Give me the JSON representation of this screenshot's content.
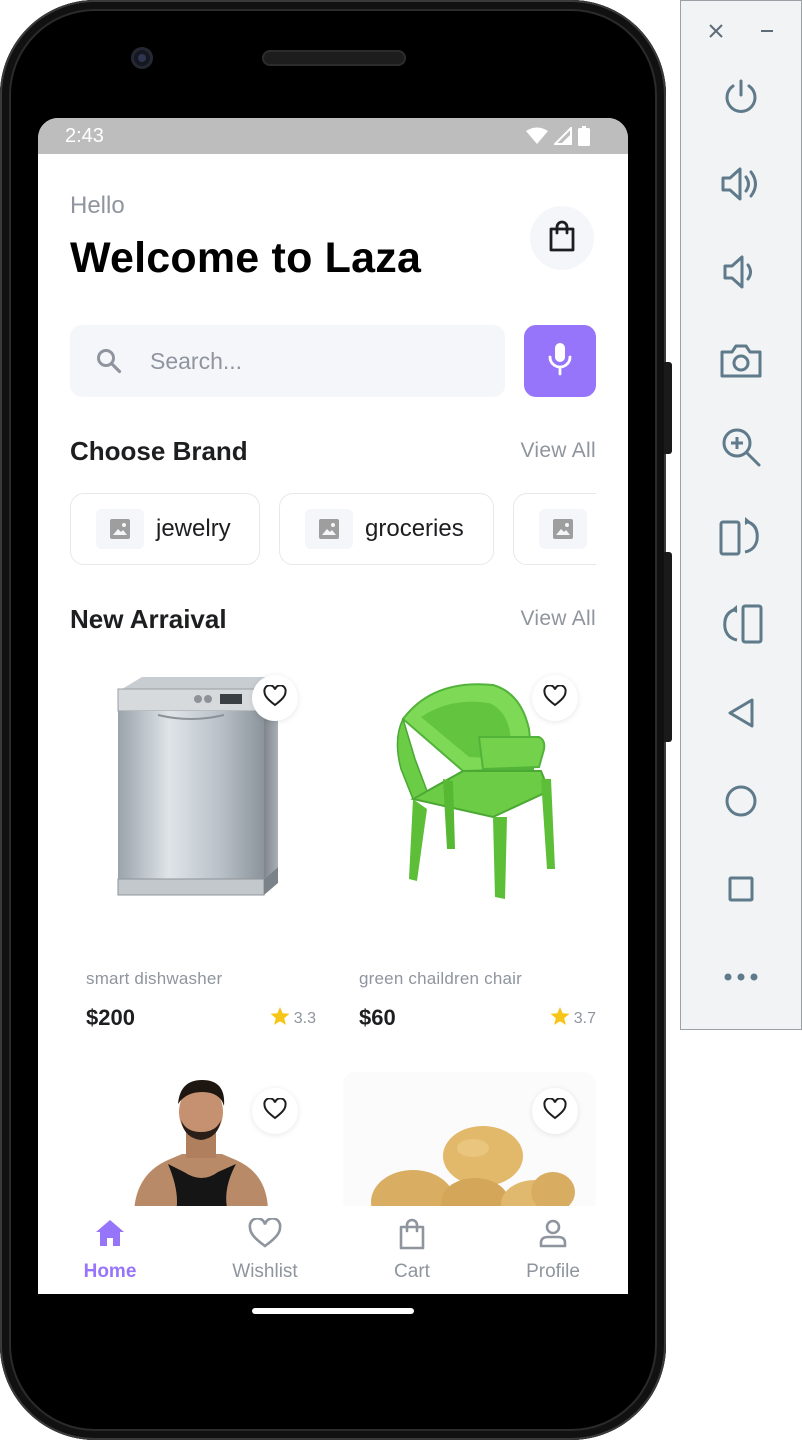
{
  "status_bar": {
    "time": "2:43"
  },
  "header": {
    "greeting": "Hello",
    "title": "Welcome to Laza"
  },
  "search": {
    "placeholder": "Search..."
  },
  "brands_section": {
    "title": "Choose Brand",
    "view_all": "View All",
    "items": [
      {
        "label": "jewelry"
      },
      {
        "label": "groceries"
      },
      {
        "label": ""
      }
    ]
  },
  "arrivals_section": {
    "title": "New Arraival",
    "view_all": "View All",
    "products": [
      {
        "name": "smart dishwasher",
        "price": "$200",
        "rating": "3.3",
        "image": "dishwasher"
      },
      {
        "name": "green chaildren chair",
        "price": "$60",
        "rating": "3.7",
        "image": "green-chair"
      },
      {
        "name": "",
        "price": "",
        "rating": "",
        "image": "man-tank-top"
      },
      {
        "name": "",
        "price": "",
        "rating": "",
        "image": "potatoes"
      }
    ]
  },
  "bottom_nav": {
    "items": [
      {
        "label": "Home",
        "icon": "home-icon",
        "active": true
      },
      {
        "label": "Wishlist",
        "icon": "heart-icon",
        "active": false
      },
      {
        "label": "Cart",
        "icon": "bag-icon",
        "active": false
      },
      {
        "label": "Profile",
        "icon": "person-icon",
        "active": false
      }
    ]
  },
  "emulator_controls": {
    "icons": [
      "close-icon",
      "minimize-icon",
      "power-icon",
      "volume-up-icon",
      "volume-down-icon",
      "camera-icon",
      "zoom-icon",
      "rotate-left-icon",
      "rotate-right-icon",
      "back-icon",
      "home-circle-icon",
      "overview-icon",
      "more-icon"
    ]
  },
  "colors": {
    "accent": "#9775fa",
    "text_primary": "#1d1e20",
    "text_secondary": "#8f959e",
    "surface": "#f5f6fa",
    "star": "#f5c518"
  }
}
